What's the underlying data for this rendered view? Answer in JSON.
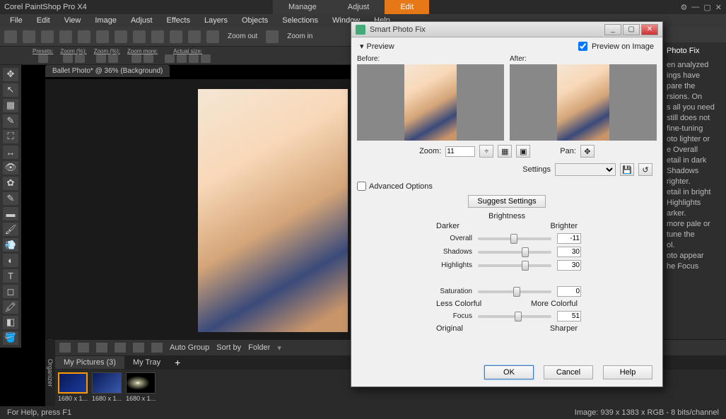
{
  "app_title": "Corel PaintShop Pro X4",
  "mode_tabs": {
    "manage": "Manage",
    "adjust": "Adjust",
    "edit": "Edit"
  },
  "menu": {
    "file": "File",
    "edit": "Edit",
    "view": "View",
    "image": "Image",
    "adjust": "Adjust",
    "effects": "Effects",
    "layers": "Layers",
    "objects": "Objects",
    "selections": "Selections",
    "window": "Window",
    "help": "Help"
  },
  "toolbar": {
    "zoom_out": "Zoom out",
    "zoom_in": "Zoom in"
  },
  "toolbar2": {
    "presets": "Presets:",
    "zoom_pct": "Zoom (%):",
    "zoom_pct2": "Zoom (%):",
    "zoom_more": "Zoom more:",
    "actual_size": "Actual size:"
  },
  "doc_tab": "Ballet Photo* @  36% (Background)",
  "right_panel": {
    "title": "Photo Fix",
    "lines": [
      "en analyzed",
      "ings have",
      "pare the",
      "rsions. On",
      "s all you need",
      "still does not",
      "fine-tuning",
      "",
      "oto lighter or",
      "e Overall",
      "",
      "etail in dark",
      "Shadows",
      "righter.",
      "etail in bright",
      "Highlights",
      "arker.",
      "more pale or",
      "tune the",
      "ol.",
      "oto appear",
      "he Focus"
    ]
  },
  "organizer": {
    "auto_group": "Auto Group",
    "sort_by": "Sort by",
    "folder": "Folder",
    "side_label": "Organizer",
    "tabs": {
      "my_pictures": "My Pictures (3)",
      "my_tray": "My Tray",
      "plus": "+"
    },
    "thumbs": [
      {
        "label": "1680 x 1..."
      },
      {
        "label": "1680 x 1..."
      },
      {
        "label": "1680 x 1..."
      }
    ]
  },
  "status": {
    "left": "For Help, press F1",
    "right": "Image:  939 x 1383 x RGB - 8 bits/channel"
  },
  "dialog": {
    "title": "Smart Photo Fix",
    "preview": "Preview",
    "preview_on_image": "Preview on Image",
    "before": "Before:",
    "after": "After:",
    "zoom_label": "Zoom:",
    "zoom_value": "11",
    "pan_label": "Pan:",
    "settings_label": "Settings",
    "advanced_options": "Advanced Options",
    "suggest": "Suggest Settings",
    "brightness": "Brightness",
    "darker": "Darker",
    "brighter": "Brighter",
    "overall": {
      "label": "Overall",
      "value": "-11"
    },
    "shadows": {
      "label": "Shadows",
      "value": "30"
    },
    "highlights": {
      "label": "Highlights",
      "value": "30"
    },
    "saturation": {
      "label": "Saturation",
      "value": "0"
    },
    "less_colorful": "Less Colorful",
    "more_colorful": "More Colorful",
    "focus": {
      "label": "Focus",
      "value": "51"
    },
    "original": "Original",
    "sharper": "Sharper",
    "ok": "OK",
    "cancel": "Cancel",
    "help": "Help"
  }
}
